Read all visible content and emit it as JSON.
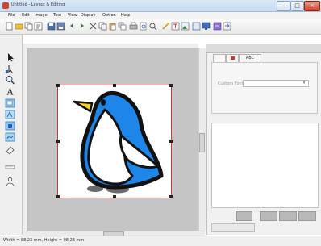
{
  "window": {
    "title": "Untitled - Layout & Editing"
  },
  "menu": {
    "items": [
      "File",
      "Edit",
      "Image",
      "Text",
      "View",
      "Display",
      "Option",
      "Help"
    ]
  },
  "panel": {
    "tabs": [
      "",
      "",
      "ABC"
    ],
    "property_label": "Custom Font"
  },
  "status": {
    "text": "Width = 88.23 mm, Height = 98.23 mm"
  },
  "colors": {
    "accent": "#1f78d6",
    "selection": "#c23b3b"
  },
  "icons": {
    "toolbar": [
      "new-file-icon",
      "open-folder-icon",
      "wizard-icon",
      "template-icon",
      "save-icon",
      "save-as-icon",
      "undo-icon",
      "redo-icon",
      "cut-icon",
      "copy-icon",
      "paste-icon",
      "duplicate-icon",
      "print-icon",
      "preview-icon",
      "zoom-icon",
      "magic-wand-icon",
      "text-tool-icon",
      "image-icon",
      "image-edit-icon",
      "screen-icon",
      "stitch-icon",
      "transfer-icon"
    ],
    "tools": [
      "select-arrow-icon",
      "point-edit-icon",
      "zoom-tool-icon",
      "text-tool-icon",
      "shape-tool-icon",
      "outline-tool-icon",
      "fill-tool-icon",
      "stitch-tool-icon",
      "eraser-icon",
      "measure-icon",
      "person-icon"
    ]
  }
}
